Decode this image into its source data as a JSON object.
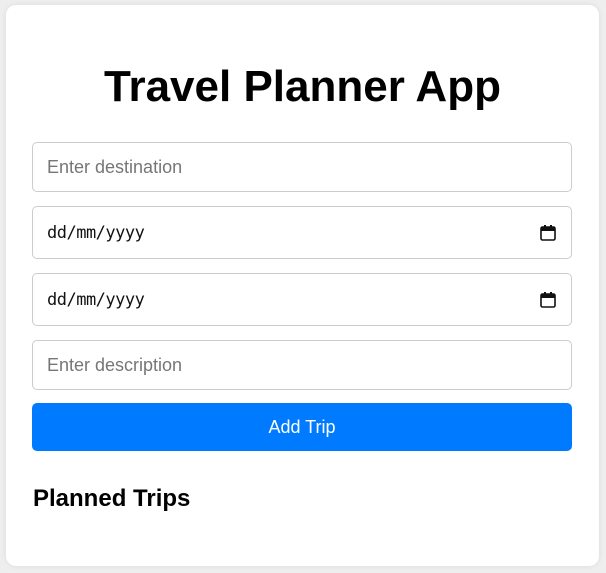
{
  "header": {
    "title": "Travel Planner App"
  },
  "form": {
    "destination": {
      "placeholder": "Enter destination",
      "value": ""
    },
    "start_date": {
      "display": "dd/mm/yyyy",
      "icon": "calendar-icon"
    },
    "end_date": {
      "display": "dd/mm/yyyy",
      "icon": "calendar-icon"
    },
    "description": {
      "placeholder": "Enter description",
      "value": ""
    },
    "add_button_label": "Add Trip"
  },
  "trips": {
    "heading": "Planned Trips",
    "items": []
  },
  "colors": {
    "accent": "#007bff",
    "background": "#eeeeee",
    "card": "#ffffff",
    "input_border": "#cccccc"
  }
}
